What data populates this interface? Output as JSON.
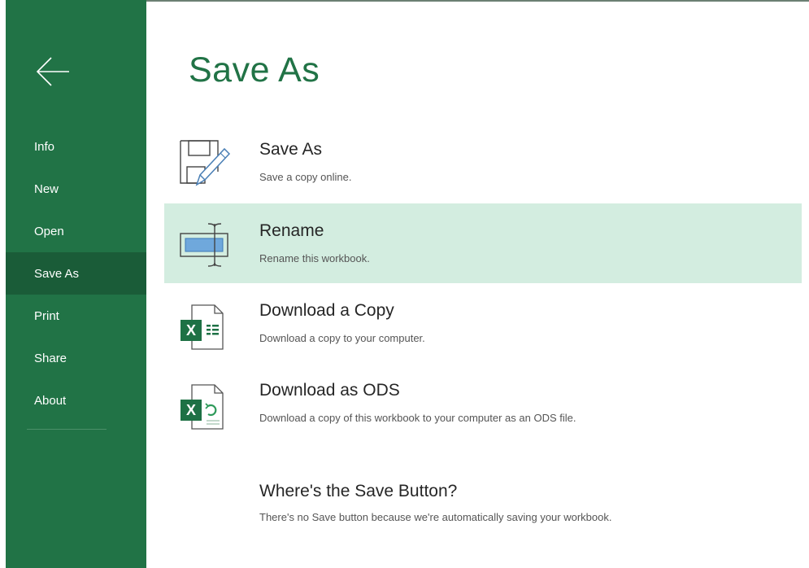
{
  "sidebar": {
    "back_icon": "back-arrow-icon",
    "items": [
      {
        "label": "Info"
      },
      {
        "label": "New"
      },
      {
        "label": "Open"
      },
      {
        "label": "Save As",
        "active": true
      },
      {
        "label": "Print"
      },
      {
        "label": "Share"
      },
      {
        "label": "About"
      }
    ]
  },
  "main": {
    "title": "Save As",
    "options": [
      {
        "title": "Save As",
        "description": "Save a copy online.",
        "icon": "save-as-pencil-icon"
      },
      {
        "title": "Rename",
        "description": "Rename this workbook.",
        "icon": "rename-icon",
        "highlighted": true
      },
      {
        "title": "Download a Copy",
        "description": "Download a copy to your computer.",
        "icon": "excel-file-icon"
      },
      {
        "title": "Download as ODS",
        "description": "Download a copy of this workbook to your computer as an ODS file.",
        "icon": "excel-ods-file-icon"
      }
    ],
    "help": {
      "title": "Where's the Save Button?",
      "description": "There's no Save button because we're automatically saving your workbook."
    }
  },
  "colors": {
    "brand": "#217346",
    "sidebar_active": "#1a5c38",
    "highlight": "#d3ede0"
  }
}
